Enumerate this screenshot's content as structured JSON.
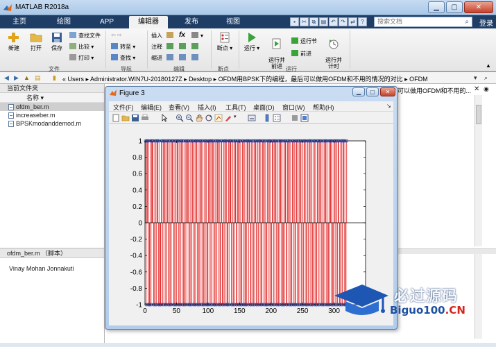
{
  "window": {
    "title": "MATLAB R2018a"
  },
  "tabs": [
    {
      "label": "主页"
    },
    {
      "label": "绘图"
    },
    {
      "label": "APP"
    },
    {
      "label": "编辑器",
      "active": true
    },
    {
      "label": "发布"
    },
    {
      "label": "视图"
    }
  ],
  "search": {
    "placeholder": "搜索文档"
  },
  "login_label": "登录",
  "ribbon": {
    "file_group": {
      "label": "文件",
      "new": "新建",
      "open": "打开",
      "save": "保存",
      "find_files": "查找文件",
      "compare": "比较",
      "print": "打印"
    },
    "nav_group": {
      "label": "导航",
      "goto": "转至",
      "find": "查找"
    },
    "edit_group": {
      "label": "编辑",
      "insert": "插入",
      "comment": "注释",
      "indent": "缩进",
      "fx": "fx"
    },
    "breakpoint_group": {
      "label": "断点",
      "breakpoints": "断点"
    },
    "run_group": {
      "label": "运行",
      "run": "运行",
      "run_advance": "运行并\n前进",
      "run_section": "运行节",
      "advance": "前进",
      "run_time": "运行并\n计时"
    }
  },
  "address": {
    "path": "«  Users  ▸  Administrator.WIN7U-20180127Z  ▸  Desktop  ▸  OFDM用BPSK下的编程，最后可以做用OFDM和不用的情况的对比  ▸  OFDM"
  },
  "left_panel": {
    "header": "当前文件夹",
    "column_header": "名称",
    "files": [
      {
        "name": "ofdm_ber.m",
        "selected": true
      },
      {
        "name": "increaseber.m",
        "selected": false
      },
      {
        "name": "BPSKmodanddemod.m",
        "selected": false
      }
    ]
  },
  "details_panel": {
    "header": "ofdm_ber.m （脚本）",
    "author": "Vinay Mohan Jonnakuti"
  },
  "right_panel": {
    "partial_text": "可以做用OFDM和不用的..."
  },
  "figure": {
    "title": "Figure 3",
    "menu": [
      "文件(F)",
      "编辑(E)",
      "查看(V)",
      "插入(I)",
      "工具(T)",
      "桌面(D)",
      "窗口(W)",
      "帮助(H)"
    ]
  },
  "chart_data": {
    "type": "stem",
    "title": "",
    "xlabel": "",
    "ylabel": "",
    "xlim": [
      0,
      350
    ],
    "ylim": [
      -1,
      1
    ],
    "xticks": [
      0,
      50,
      100,
      150,
      200,
      250,
      300,
      350
    ],
    "yticks": [
      -1,
      -0.8,
      -0.6,
      -0.4,
      -0.2,
      0,
      0.2,
      0.4,
      0.6,
      0.8,
      1
    ],
    "color": "#e02020",
    "marker_color": "#1a3fc8",
    "x_range": [
      1,
      320
    ],
    "values_note": "binary BPSK symbols, each stem value is +1 or -1",
    "values": [
      1,
      -1,
      1,
      1,
      -1,
      1,
      -1,
      -1,
      1,
      -1,
      1,
      1,
      1,
      -1,
      -1,
      1,
      -1,
      1,
      -1,
      1,
      1,
      -1,
      1,
      -1,
      -1,
      -1,
      1,
      1,
      -1,
      1,
      -1,
      1,
      1,
      -1,
      -1,
      1,
      1,
      -1,
      1,
      -1,
      1,
      -1,
      -1,
      1,
      1,
      1,
      -1,
      -1,
      1,
      -1,
      1,
      -1,
      1,
      1,
      -1,
      1,
      -1,
      -1,
      1,
      1,
      -1,
      1,
      -1,
      1,
      -1,
      -1,
      1,
      1,
      -1,
      1,
      1,
      -1,
      -1,
      1,
      -1,
      1,
      -1,
      1,
      1,
      -1,
      -1,
      1,
      -1,
      1,
      1,
      -1,
      1,
      -1,
      -1,
      1,
      1,
      -1,
      1,
      -1,
      1,
      -1,
      -1,
      1,
      1,
      -1,
      1,
      -1,
      -1,
      1,
      -1,
      1,
      1,
      -1,
      1,
      -1,
      1,
      1,
      -1,
      -1,
      1,
      -1,
      1,
      -1,
      1,
      1,
      -1,
      1,
      -1,
      -1,
      1,
      1,
      -1,
      -1,
      1,
      -1,
      1,
      1,
      -1,
      1,
      -1,
      -1,
      1,
      -1,
      1,
      1,
      1,
      -1,
      -1,
      1,
      -1,
      1,
      -1,
      1,
      1,
      -1,
      -1,
      1,
      1,
      -1,
      1,
      -1,
      1,
      -1,
      -1,
      1,
      1,
      -1,
      1,
      -1,
      -1,
      1,
      -1,
      1,
      1,
      -1,
      1,
      1,
      -1,
      -1,
      1,
      -1,
      1,
      -1,
      1,
      -1,
      1,
      1,
      -1,
      -1,
      1,
      -1,
      1,
      1,
      -1,
      1,
      -1,
      -1,
      1,
      1,
      -1,
      1,
      -1,
      1,
      -1,
      -1,
      1,
      -1,
      1,
      1,
      -1,
      1,
      -1,
      -1,
      1,
      1,
      -1,
      1,
      -1,
      1,
      1,
      -1,
      -1,
      1,
      -1,
      1,
      -1,
      1,
      1,
      -1,
      1,
      -1,
      -1,
      1,
      -1,
      1,
      1,
      -1,
      -1,
      1,
      1,
      -1,
      1,
      -1,
      1,
      -1,
      -1,
      1,
      1,
      -1,
      1,
      -1,
      -1,
      1,
      1,
      -1,
      1,
      -1,
      1,
      -1,
      1,
      1,
      -1,
      -1,
      1,
      -1,
      1,
      1,
      -1,
      1,
      -1,
      -1,
      1,
      -1,
      1,
      1,
      -1,
      1,
      -1,
      1,
      -1,
      -1,
      1,
      1,
      -1,
      1,
      -1,
      -1,
      1,
      1,
      -1,
      1,
      -1,
      1,
      1,
      -1,
      -1,
      1,
      -1,
      1,
      -1,
      1,
      1,
      -1,
      1,
      -1,
      -1,
      1,
      -1,
      1,
      1,
      -1,
      1,
      -1,
      -1,
      1,
      1,
      -1,
      1,
      -1,
      1,
      -1,
      1,
      1,
      -1,
      -1,
      1,
      -1,
      1,
      -1,
      1,
      1,
      -1,
      1,
      -1,
      -1,
      1
    ]
  },
  "watermark": {
    "cn": "必过源码",
    "en_main": "Biguo100",
    "en_suffix": ".CN"
  }
}
